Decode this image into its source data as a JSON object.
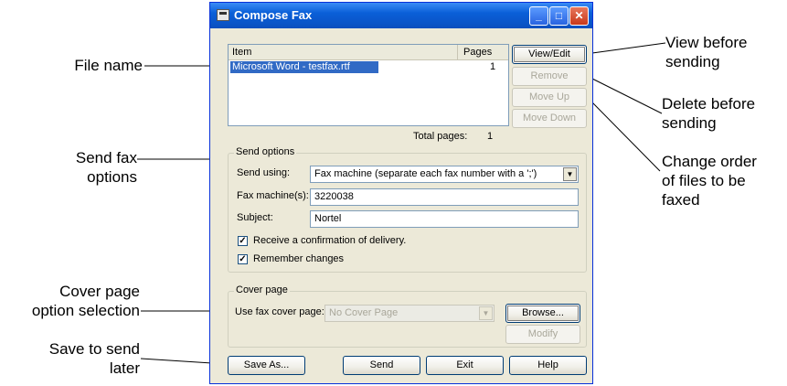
{
  "annotations": {
    "file_name": "File name",
    "send_fax_options": [
      "Send fax",
      "options"
    ],
    "cover_page": [
      "Cover page",
      "option selection"
    ],
    "save_later": [
      "Save to send",
      "later"
    ],
    "view_before": [
      "View before",
      "sending"
    ],
    "delete_before": [
      "Delete before",
      "sending"
    ],
    "change_order": [
      "Change order",
      "of files to be",
      "faxed"
    ]
  },
  "window": {
    "title": "Compose Fax",
    "titlebar_buttons": {
      "minimize": "_",
      "maximize": "□",
      "close": "✕"
    }
  },
  "file_list": {
    "columns": {
      "item": "Item",
      "pages": "Pages"
    },
    "rows": [
      {
        "item": "Microsoft Word - testfax.rtf",
        "pages": "1"
      }
    ],
    "total_label": "Total pages:",
    "total_value": "1"
  },
  "side_buttons": {
    "view_edit": "View/Edit",
    "remove": "Remove",
    "move_up": "Move Up",
    "move_down": "Move Down"
  },
  "send_options": {
    "group_label": "Send options",
    "send_using_label": "Send using:",
    "send_using_value": "Fax machine (separate each fax number with a ';')",
    "fax_machine_label": "Fax machine(s):",
    "fax_machine_value": "3220038",
    "subject_label": "Subject:",
    "subject_value": "Nortel",
    "confirm_label": "Receive a confirmation of delivery.",
    "confirm_checked": true,
    "remember_label": "Remember changes",
    "remember_checked": true
  },
  "cover_page": {
    "group_label": "Cover page",
    "use_label": "Use fax cover page:",
    "use_value": "No Cover Page",
    "browse": "Browse...",
    "modify": "Modify"
  },
  "bottom_buttons": {
    "save_as": "Save As...",
    "send": "Send",
    "exit": "Exit",
    "help": "Help"
  },
  "colors": {
    "titlebar": "#0a5fd8",
    "dialog_bg": "#ece9d8",
    "selection": "#316ac5"
  }
}
